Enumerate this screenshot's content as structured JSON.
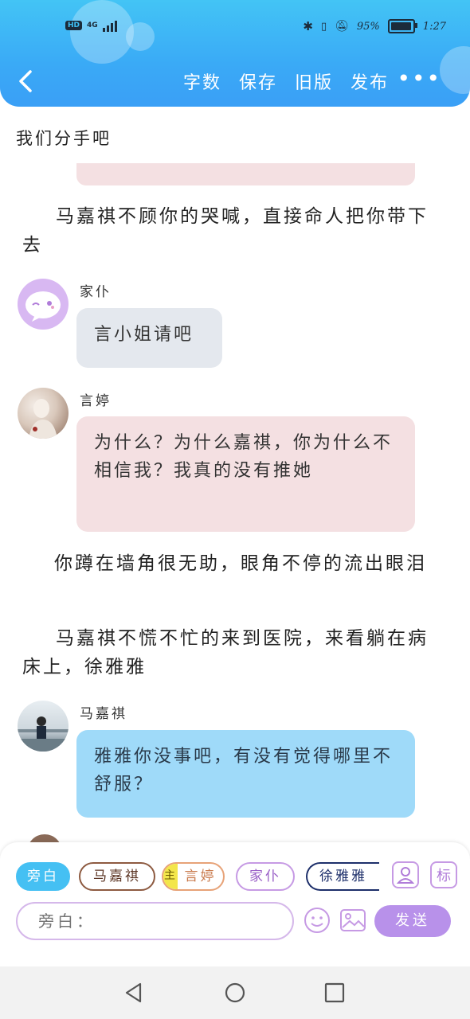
{
  "status_bar": {
    "hd": "HD",
    "network": "4G",
    "battery_text": "95%",
    "time": "1:27"
  },
  "header": {
    "actions": [
      "字数",
      "保存",
      "旧版",
      "发布"
    ],
    "more": "•••"
  },
  "chat": {
    "title": "我们分手吧",
    "narration_1": "马嘉祺不顾你的哭喊，直接命人把你带下去",
    "msg_servant": {
      "speaker": "家仆",
      "text": "言小姐请吧"
    },
    "msg_yan": {
      "speaker": "言婷",
      "text": "为什么？为什么嘉祺，你为什么不相信我？我真的没有推她"
    },
    "narration_2": "你蹲在墙角很无助，眼角不停的流出眼泪",
    "narration_3": "马嘉祺不慌不忙的来到医院，来看躺在病床上，徐雅雅",
    "msg_ma": {
      "speaker": "马嘉祺",
      "text": "雅雅你没事吧，有没有觉得哪里不舒服？"
    }
  },
  "composer": {
    "chips": {
      "narration": "旁白",
      "ma": "马嘉祺",
      "yan_main_tag": "主",
      "yan": "言婷",
      "servant": "家仆",
      "xu": "徐雅雅"
    },
    "tag_button": "标",
    "input_placeholder": "旁白：",
    "send": "发送"
  },
  "colors": {
    "header": "#3aaaf6",
    "accent_purple": "#b891ea",
    "bubble_pink": "#f4e0e2",
    "bubble_blue": "#9fdaf9",
    "bubble_grey": "#e4e8ee"
  }
}
